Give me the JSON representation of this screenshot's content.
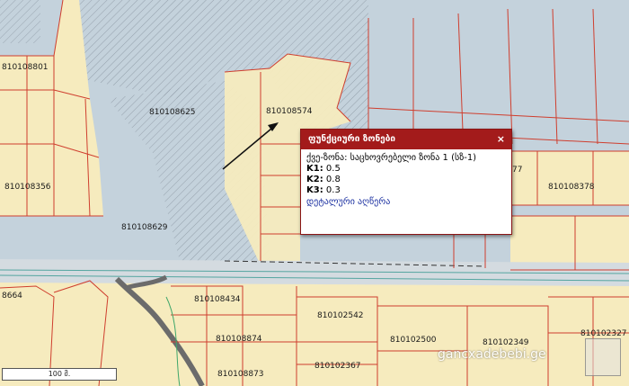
{
  "map": {
    "parcel_labels": [
      "810108801",
      "810108625",
      "810108574",
      "810108356",
      "810108629",
      "810108378",
      "77",
      "8664",
      "810108434",
      "810102542",
      "810108874",
      "810102500",
      "810102349",
      "810102327",
      "810108873",
      "810102367"
    ],
    "colors": {
      "background": "#c4d2dc",
      "residential_zone": "#f6ebbe",
      "parcel_outline": "#cf3e2e",
      "hatch": "#8d98a4",
      "road": "#d4dbe0",
      "popup_header": "#a31b1b",
      "link": "#1a2fa0"
    }
  },
  "popup": {
    "title": "ფუნქციური ზონები",
    "close_glyph": "×",
    "zone_label": "ქვე-ზონა:",
    "zone_value": "საცხოვრებელი ზონა 1 (სზ-1)",
    "k1_label": "K1:",
    "k1_value": "0.5",
    "k2_label": "K2:",
    "k2_value": "0.8",
    "k3_label": "K3:",
    "k3_value": "0.3",
    "link_text": "დეტალური აღწერა"
  },
  "scale": {
    "label": "100 მ."
  },
  "watermark": {
    "text": "gancxadebebi.ge"
  }
}
